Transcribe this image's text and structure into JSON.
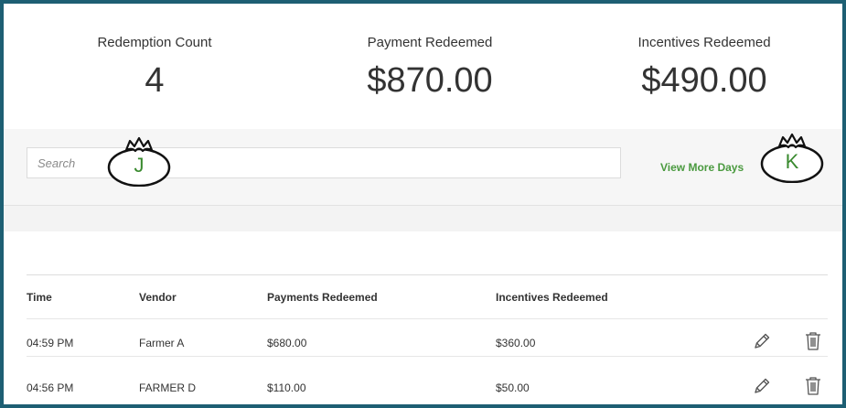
{
  "stats": [
    {
      "label": "Redemption Count",
      "value": "4"
    },
    {
      "label": "Payment Redeemed",
      "value": "$870.00"
    },
    {
      "label": "Incentives Redeemed",
      "value": "$490.00"
    }
  ],
  "search": {
    "placeholder": "Search"
  },
  "view_more_label": "View More Days",
  "annotations": {
    "j": "J",
    "k": "K"
  },
  "table": {
    "headers": [
      "Time",
      "Vendor",
      "Payments Redeemed",
      "Incentives Redeemed"
    ],
    "rows": [
      {
        "time": "04:59 PM",
        "vendor": "Farmer A",
        "payments": "$680.00",
        "incentives": "$360.00"
      },
      {
        "time": "04:56 PM",
        "vendor": "FARMER D",
        "payments": "$110.00",
        "incentives": "$50.00"
      }
    ]
  },
  "icons": {
    "edit": "pencil-icon",
    "delete": "trash-icon"
  }
}
